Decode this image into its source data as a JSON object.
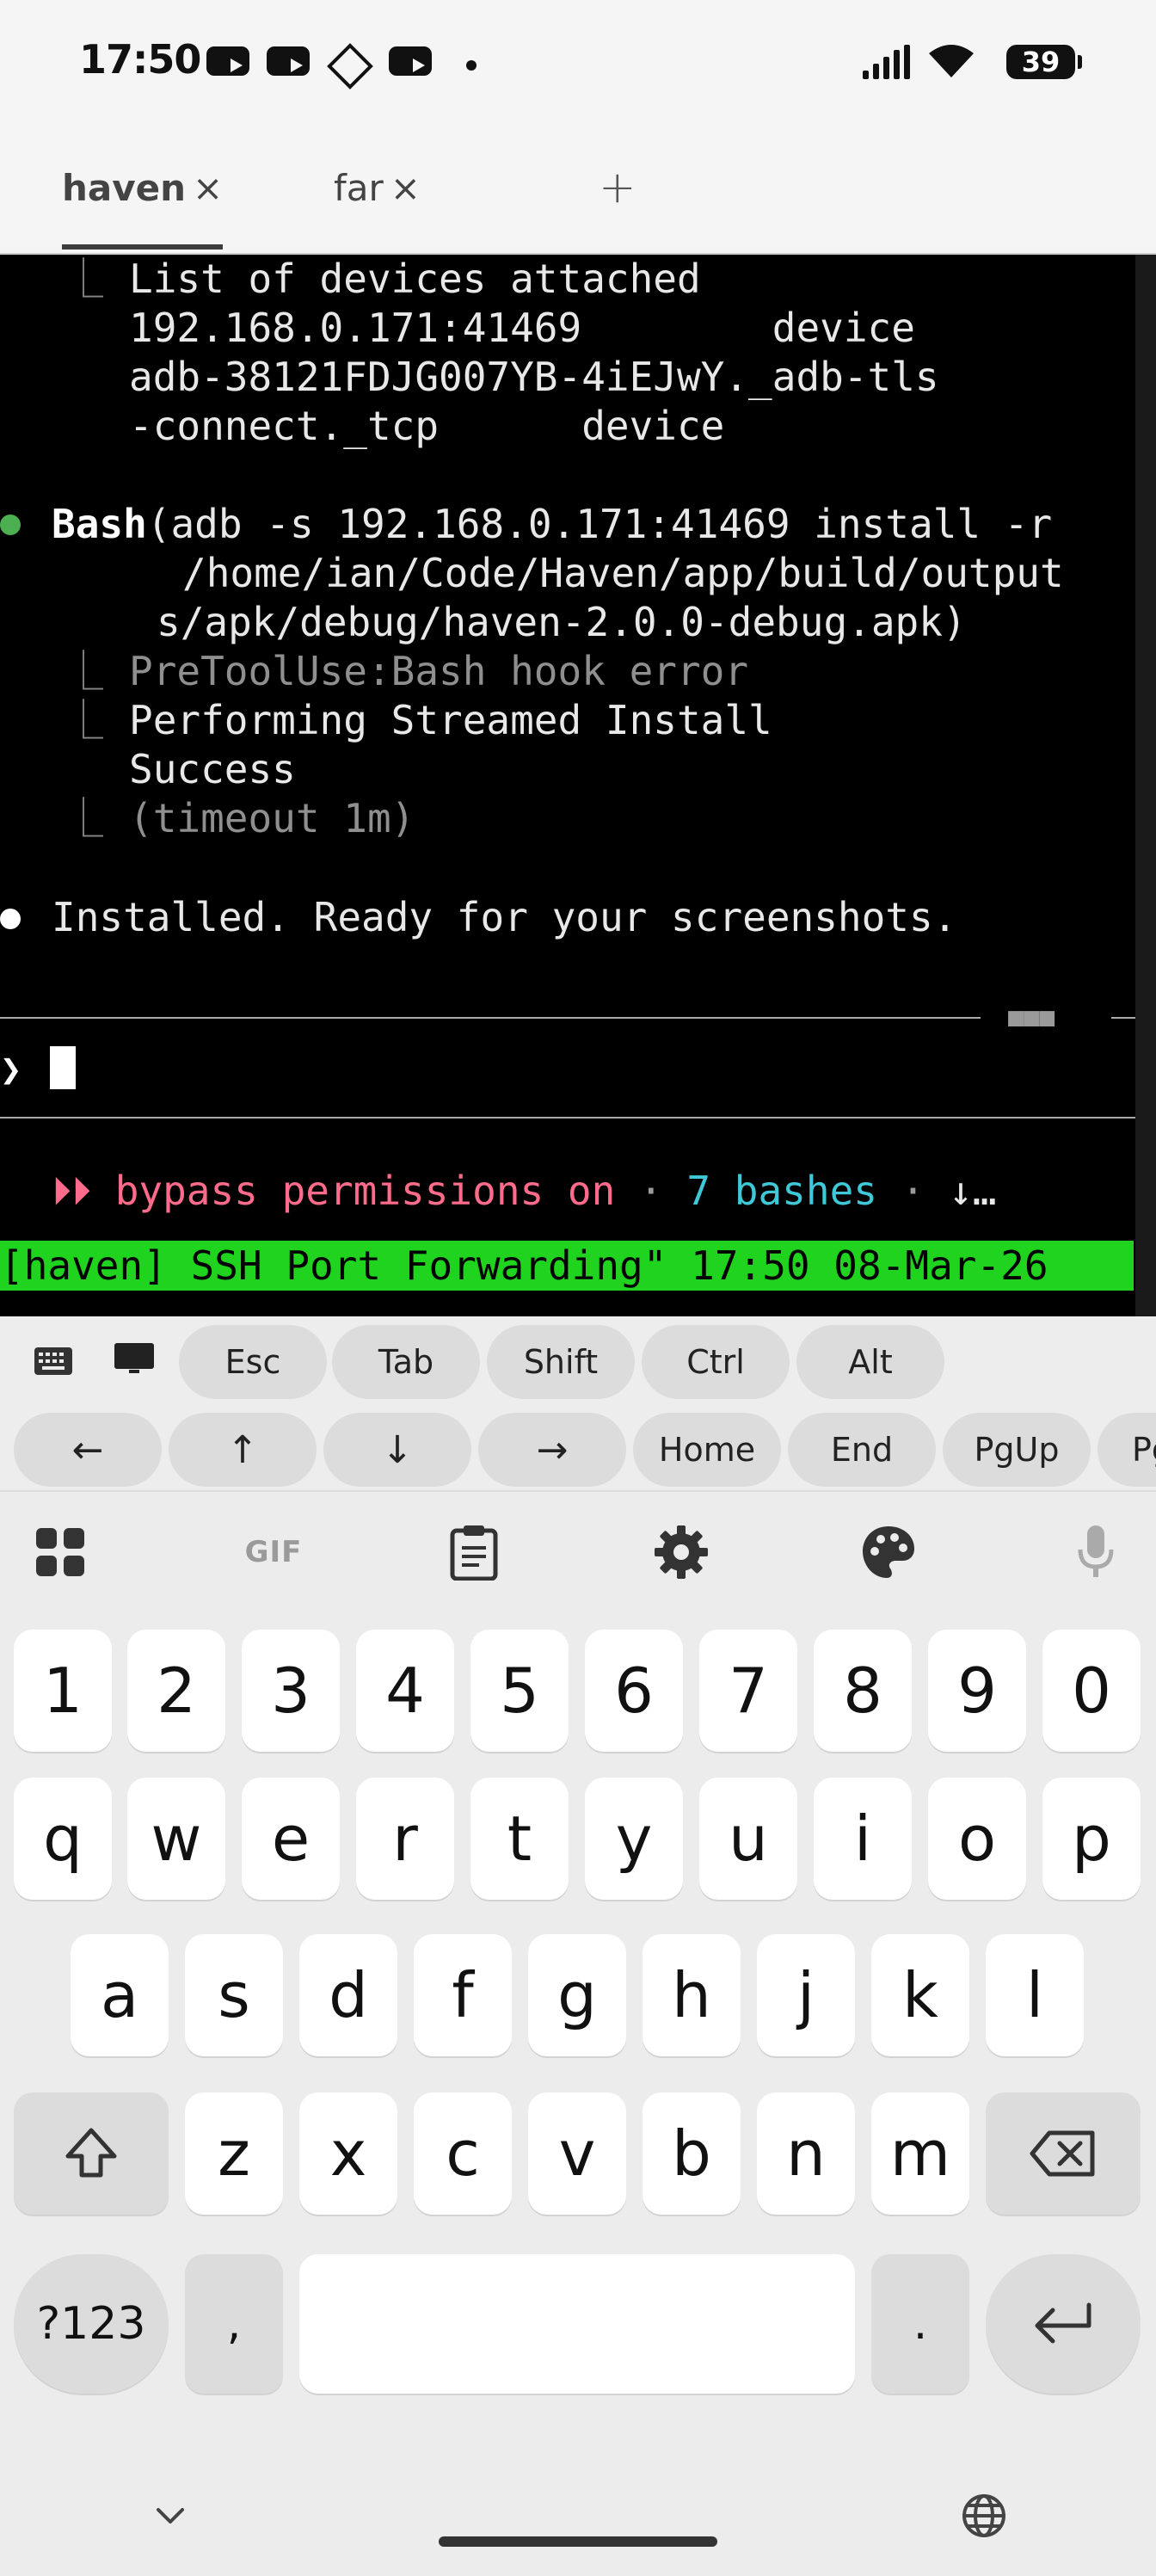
{
  "status_bar": {
    "time": "17:50",
    "battery": "39",
    "notification_icons": [
      "youtube-icon",
      "youtube-icon",
      "diamond-icon",
      "youtube-icon",
      "dot-icon"
    ]
  },
  "tabs": [
    {
      "label": "haven",
      "close": "×"
    },
    {
      "label": "far",
      "close": "×"
    }
  ],
  "add_tab": "+",
  "terminal": {
    "line1": "List of devices attached",
    "line2": "192.168.0.171:41469        device",
    "line3": "adb-38121FDJG007YB-4iEJwY._adb-tls",
    "line4": "-connect._tcp      device",
    "bash_name": "Bash",
    "bash_cmd1": "(adb -s 192.168.0.171:41469 install -r",
    "bash_cmd2": "/home/ian/Code/Haven/app/build/output",
    "bash_cmd3": "s/apk/debug/haven-2.0.0-debug.apk)",
    "hook_error": "PreToolUse:Bash hook error",
    "streamed": "Performing Streamed Install",
    "success": "Success",
    "timeout": "(timeout 1m)",
    "installed": "Installed. Ready for your screenshots.",
    "prompt": "❯",
    "status_glyphs": "⏵⏵",
    "bypass": "bypass permissions on",
    "sep": "·",
    "bashes": "7 bashes",
    "arrow_more": "↓…",
    "tmux_status": "[haven] SSH Port Forwarding\" 17:50 08-Mar-26",
    "rule_dots": "■■■"
  },
  "extra_keys": {
    "row1": [
      "Esc",
      "Tab",
      "Shift",
      "Ctrl",
      "Alt"
    ],
    "row2": [
      "←",
      "↑",
      "↓",
      "→",
      "Home",
      "End",
      "PgUp",
      "Pg"
    ]
  },
  "keyboard": {
    "toolbar_icons": [
      "apps-grid-icon",
      "gif-icon",
      "clipboard-icon",
      "settings-gear-icon",
      "palette-icon",
      "microphone-icon"
    ],
    "gif_label": "GIF",
    "digits": [
      "1",
      "2",
      "3",
      "4",
      "5",
      "6",
      "7",
      "8",
      "9",
      "0"
    ],
    "row_q": [
      "q",
      "w",
      "e",
      "r",
      "t",
      "y",
      "u",
      "i",
      "o",
      "p"
    ],
    "row_a": [
      "a",
      "s",
      "d",
      "f",
      "g",
      "h",
      "j",
      "k",
      "l"
    ],
    "row_z": [
      "z",
      "x",
      "c",
      "v",
      "b",
      "n",
      "m"
    ],
    "symbols": "?123",
    "comma": ",",
    "period": ".",
    "hide_icon": "chevron-down-icon",
    "language_icon": "globe-icon"
  },
  "colors": {
    "terminal_bg": "#000000",
    "tmux_green": "#1fd31f",
    "bypass_pink": "#ff6b8b",
    "bashes_cyan": "#3fc8d8",
    "green_bullet": "#4caf50"
  }
}
